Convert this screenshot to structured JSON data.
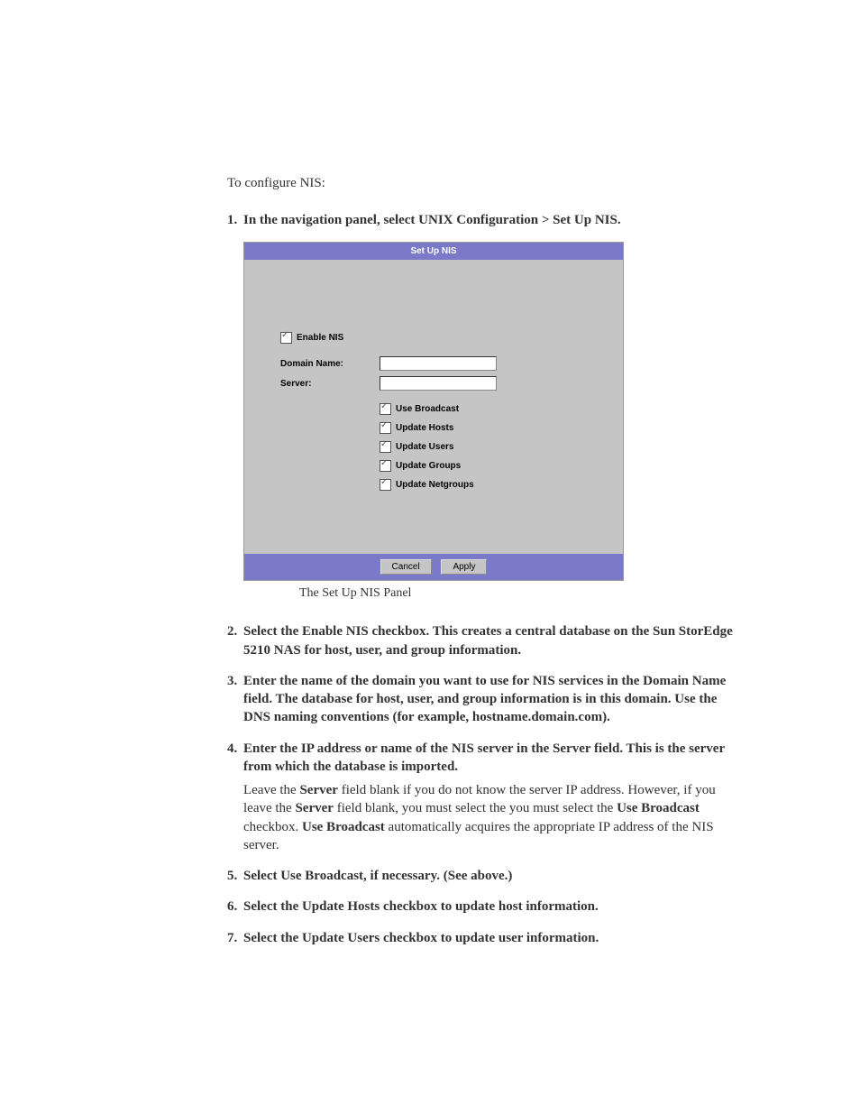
{
  "intro": "To configure NIS:",
  "steps": {
    "s1": {
      "num": "1.",
      "text": "In the navigation panel, select UNIX Configuration > Set Up NIS."
    },
    "s2": {
      "num": "2.",
      "text": "Select the Enable NIS checkbox. This creates a central database on the Sun StorEdge 5210 NAS for host, user, and group information."
    },
    "s3": {
      "num": "3.",
      "text": "Enter the name of the domain you want to use for NIS services in the Domain Name field. The database for host, user, and group information is in this domain. Use the DNS naming conventions (for example, hostname.domain.com)."
    },
    "s4": {
      "num": "4.",
      "text": "Enter the IP address or name of the NIS server in the Server field. This is the server from which the database is imported.",
      "body_prefix": "Leave the ",
      "b1": "Server",
      "body_mid1": " field blank if you do not know the server IP address. However, if you leave the ",
      "b2": "Server",
      "body_mid2": " field blank, you must select the you must select the ",
      "b3": "Use Broadcast",
      "body_mid3": " checkbox. ",
      "b4": "Use Broadcast",
      "body_suffix": " automatically acquires the appropriate IP address of the NIS server."
    },
    "s5": {
      "num": "5.",
      "text": "Select Use Broadcast, if necessary. (See above.)"
    },
    "s6": {
      "num": "6.",
      "text": "Select the Update Hosts checkbox to update host information."
    },
    "s7": {
      "num": "7.",
      "text": "Select the Update Users checkbox to update user information."
    }
  },
  "panel": {
    "title": "Set Up NIS",
    "enable": "Enable NIS",
    "domain_label": "Domain Name:",
    "server_label": "Server:",
    "domain_value": "",
    "server_value": "",
    "use_broadcast": "Use Broadcast",
    "update_hosts": "Update Hosts",
    "update_users": "Update Users",
    "update_groups": "Update Groups",
    "update_netgroups": "Update Netgroups",
    "cancel": "Cancel",
    "apply": "Apply"
  },
  "caption": "The Set Up NIS Panel"
}
